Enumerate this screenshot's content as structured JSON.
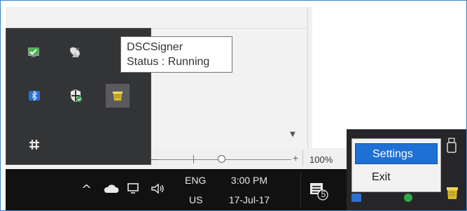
{
  "tooltip": {
    "app_name": "DSCSigner",
    "status": "Status : Running"
  },
  "overflow_tray": {
    "icons": [
      {
        "name": "security-shield-icon",
        "color": "#3fb84a"
      },
      {
        "name": "satellite-dish-icon",
        "color": "#d9d9d9"
      },
      {
        "name": "bluetooth-icon",
        "color": "#2b6fd0"
      },
      {
        "name": "windows-defender-icon",
        "color": "#e8e8e8"
      },
      {
        "name": "dscsigner-tray-icon",
        "color": "#e3c23a"
      },
      {
        "name": "network-settings-icon",
        "color": "#e8e8e8"
      }
    ]
  },
  "zoom": {
    "minus": "—",
    "plus": "+",
    "level": "100%"
  },
  "taskbar": {
    "chevron": "^",
    "lang_code": "ENG",
    "region": "US",
    "time": "3:00 PM",
    "date": "17-Jul-17",
    "notification_count": "5"
  },
  "context_menu": {
    "items": [
      "Settings",
      "Exit"
    ]
  },
  "colors": {
    "taskbar": "#111112",
    "flyout": "#333436",
    "menu_highlight": "#1e70d4"
  }
}
